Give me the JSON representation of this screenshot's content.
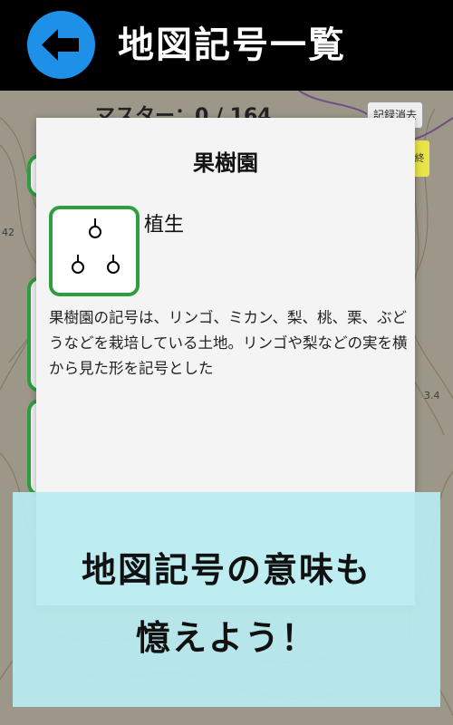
{
  "header": {
    "title": "地図記号一覧",
    "back_icon": "arrow-left-icon",
    "accent_color": "#1e90e8"
  },
  "list": {
    "master_text": "マスター：0 / 164",
    "clear_record_label": "記録消去",
    "side_tab_label": "終"
  },
  "modal": {
    "title": "果樹園",
    "category": "植生",
    "symbol_icon": "orchard-symbol-icon",
    "description": "果樹園の記号は、リンゴ、ミカン、梨、桃、栗、ぶどうなどを栽培している土地。リンゴや梨などの実を横から見た形を記号とした",
    "border_color": "#2e9e3e"
  },
  "banner": {
    "line1": "地図記号の意味も",
    "line2": "憶えよう！",
    "background": "#b8ecf0"
  },
  "map_labels": [
    "42",
    "3.4"
  ]
}
